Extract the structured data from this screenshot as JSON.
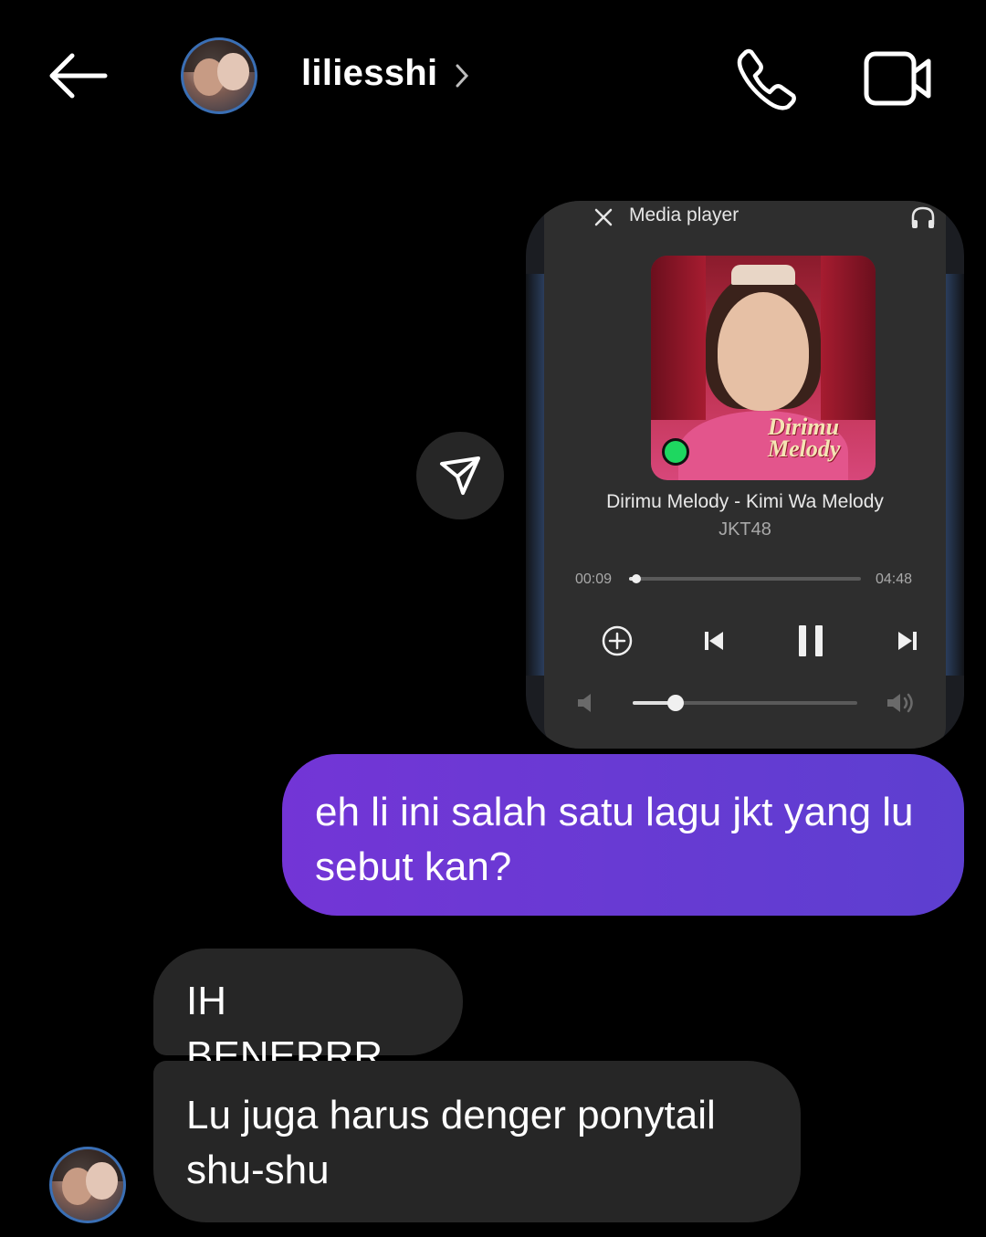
{
  "header": {
    "back_icon": "arrow-left-icon",
    "username": "liliesshi",
    "call_icon": "phone-icon",
    "video_icon": "video-camera-icon"
  },
  "media_player": {
    "title": "Media player",
    "song_title": "Dirimu Melody - Kimi Wa Melody",
    "artist": "JKT48",
    "album_art_text": "Dirimu Melody",
    "current_time": "00:09",
    "duration": "04:48",
    "progress_fraction": 0.03,
    "volume_fraction": 0.19,
    "controls": [
      "add-icon",
      "previous-icon",
      "pause-icon",
      "next-icon"
    ]
  },
  "messages": [
    {
      "from": "me",
      "text": "eh li ini salah satu lagu jkt yang lu sebut kan?"
    },
    {
      "from": "them",
      "text": "IH BENERRR"
    },
    {
      "from": "them",
      "text": "Lu juga harus denger ponytail shu-shu"
    }
  ],
  "colors": {
    "background": "#000000",
    "sent_bubble_start": "#7335d6",
    "sent_bubble_end": "#5d3fd0",
    "received_bubble": "#262626"
  }
}
